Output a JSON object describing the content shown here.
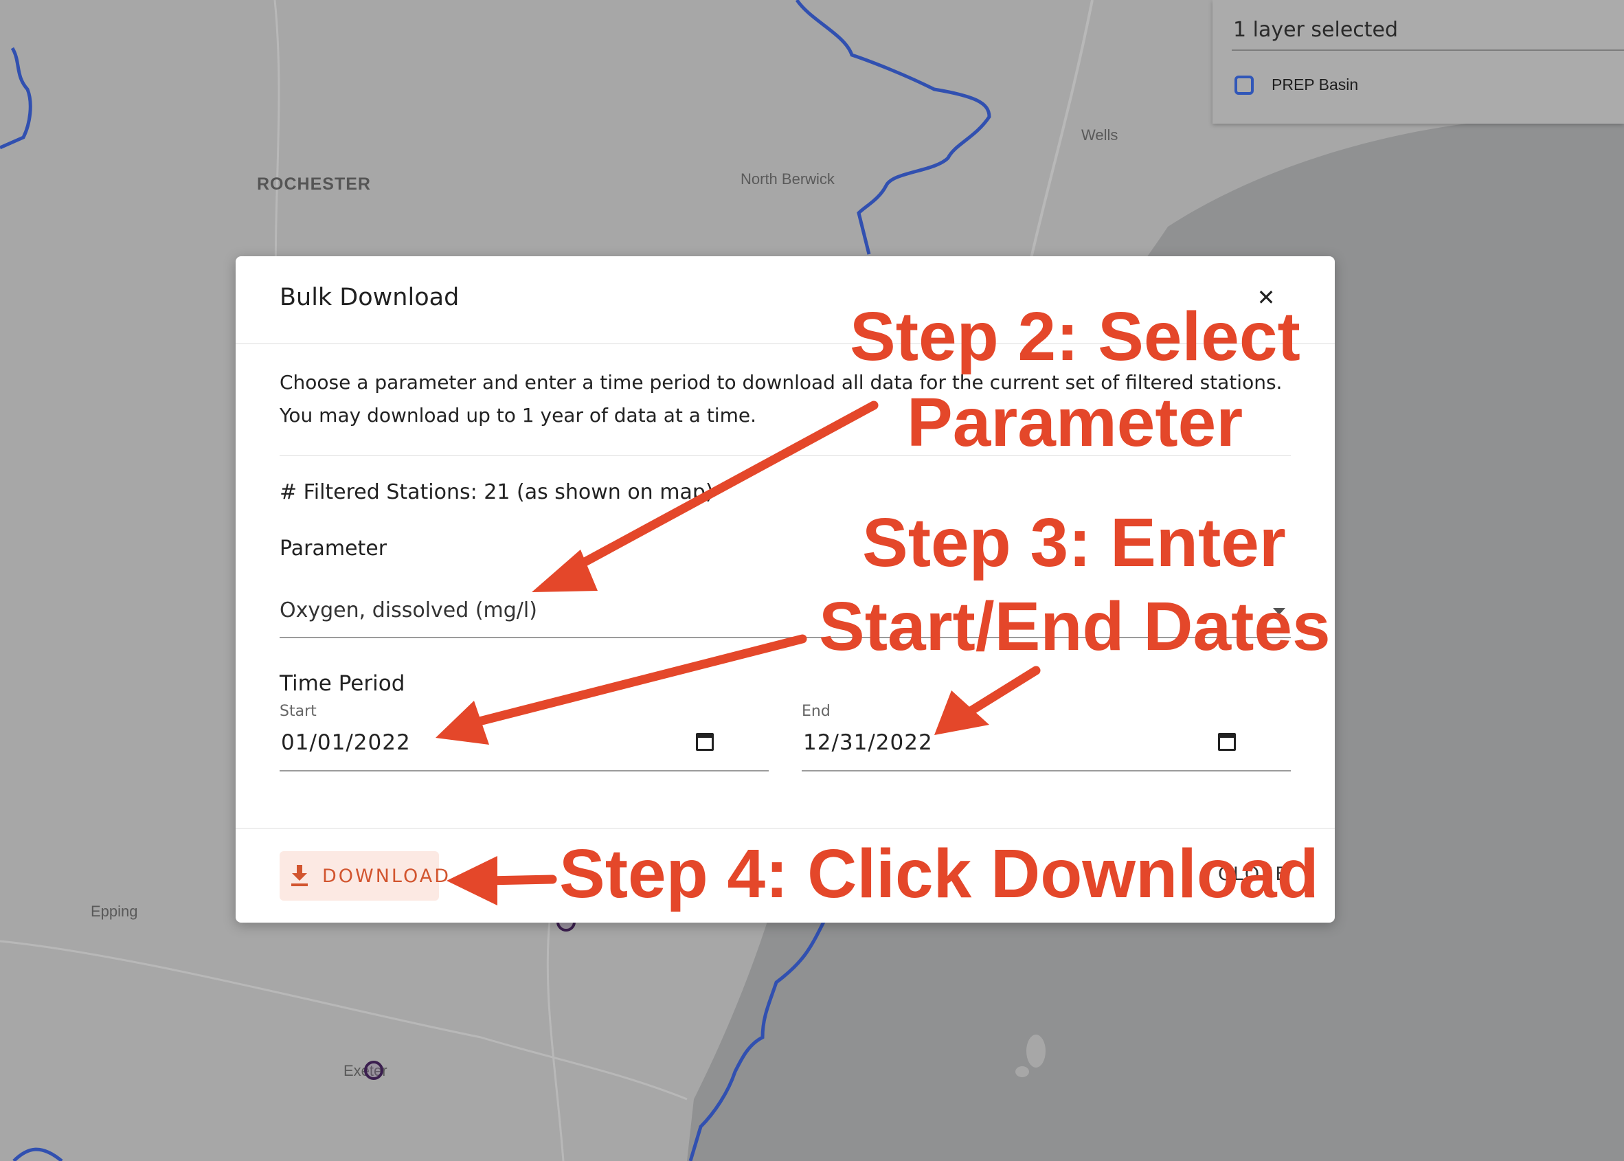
{
  "map": {
    "labels": {
      "rochester": "ROCHESTER",
      "north_berwick": "North Berwick",
      "wells": "Wells",
      "epping": "Epping",
      "exeter": "Exeter"
    },
    "colors": {
      "land": "#a7a7a7",
      "water": "#8f9091",
      "boundary": "#3150b0"
    }
  },
  "layer_panel": {
    "summary": "1 layer selected",
    "layers": [
      {
        "name": "PREP Basin",
        "checked": false
      }
    ]
  },
  "modal": {
    "title": "Bulk Download",
    "close_icon": "close-icon",
    "description": "Choose a parameter and enter a time period to download all data for the current set of filtered stations. You may download up to 1 year of data at a time.",
    "filtered_stations": "# Filtered Stations: 21 (as shown on map)",
    "parameter": {
      "label": "Parameter",
      "value": "Oxygen, dissolved (mg/l)"
    },
    "time_period": {
      "label": "Time Period",
      "start": {
        "label": "Start",
        "value": "01/01/2022"
      },
      "end": {
        "label": "End",
        "value": "12/31/2022"
      }
    },
    "download_button": {
      "label": "DOWNLOAD",
      "icon": "download-icon"
    },
    "close_button": {
      "label": "CLOSE"
    }
  },
  "annotations": {
    "color": "#e4472a",
    "step2": [
      "Step 2: Select",
      "Parameter"
    ],
    "step3": [
      "Step 3: Enter",
      "Start/End Dates"
    ],
    "step4": "Step 4: Click Download"
  }
}
